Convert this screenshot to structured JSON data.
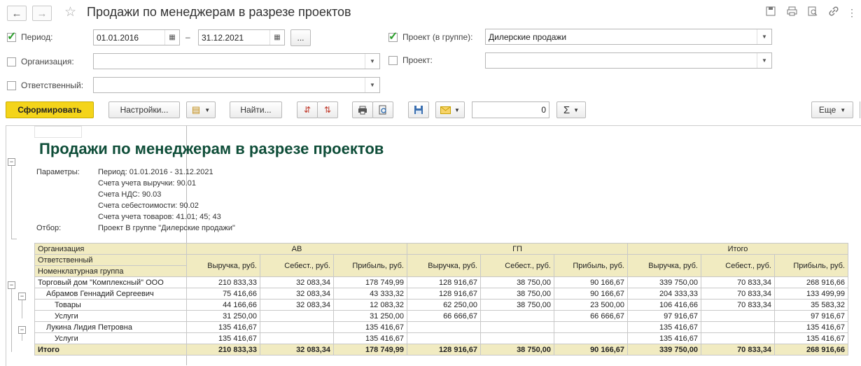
{
  "window": {
    "title": "Продажи по менеджерам в разрезе проектов",
    "back_icon": "arrow-left-icon",
    "forward_icon": "arrow-right-icon"
  },
  "form": {
    "period": {
      "label": "Период:",
      "checked": true,
      "from": "01.01.2016",
      "dash": "–",
      "to": "31.12.2021",
      "more": "..."
    },
    "organization": {
      "label": "Организация:",
      "checked": false,
      "value": ""
    },
    "responsible": {
      "label": "Ответственный:",
      "checked": false,
      "value": ""
    },
    "project_group": {
      "label": "Проект (в группе):",
      "checked": true,
      "value": "Дилерские продажи"
    },
    "project": {
      "label": "Проект:",
      "checked": false,
      "value": ""
    }
  },
  "toolbar": {
    "generate": "Сформировать",
    "settings": "Настройки...",
    "find": "Найти...",
    "sum_value": "0",
    "sigma": "Σ",
    "more": "Еще"
  },
  "report": {
    "title": "Продажи по менеджерам в разрезе проектов",
    "params_label": "Параметры:",
    "params": [
      "Период: 01.01.2016 - 31.12.2021",
      "Счета учета выручки: 90.01",
      "Счета НДС: 90.03",
      "Счета себестоимости: 90.02",
      "Счета учета товаров: 41.01; 45; 43"
    ],
    "filter_label": "Отбор:",
    "filter": "Проект В группе \"Дилерские продажи\"",
    "header": {
      "org": "Организация",
      "resp": "Ответственный",
      "group": "Номенклатурная группа",
      "projects": [
        "АВ",
        "ГП",
        "Итого"
      ],
      "cols": [
        "Выручка, руб.",
        "Себест., руб.",
        "Прибыль, руб."
      ]
    },
    "rows": [
      {
        "name": "Торговый дом \"Комплексный\" ООО",
        "v": [
          "210 833,33",
          "32 083,34",
          "178 749,99",
          "128 916,67",
          "38 750,00",
          "90 166,67",
          "339 750,00",
          "70 833,34",
          "268 916,66"
        ]
      },
      {
        "name": "Абрамов Геннадий Сергеевич",
        "v": [
          "75 416,66",
          "32 083,34",
          "43 333,32",
          "128 916,67",
          "38 750,00",
          "90 166,67",
          "204 333,33",
          "70 833,34",
          "133 499,99"
        ]
      },
      {
        "name": "Товары",
        "v": [
          "44 166,66",
          "32 083,34",
          "12 083,32",
          "62 250,00",
          "38 750,00",
          "23 500,00",
          "106 416,66",
          "70 833,34",
          "35 583,32"
        ]
      },
      {
        "name": "Услуги",
        "v": [
          "31 250,00",
          "",
          "31 250,00",
          "66 666,67",
          "",
          "66 666,67",
          "97 916,67",
          "",
          "97 916,67"
        ]
      },
      {
        "name": "Лукина Лидия Петровна",
        "v": [
          "135 416,67",
          "",
          "135 416,67",
          "",
          "",
          "",
          "135 416,67",
          "",
          "135 416,67"
        ]
      },
      {
        "name": "Услуги",
        "v": [
          "135 416,67",
          "",
          "135 416,67",
          "",
          "",
          "",
          "135 416,67",
          "",
          "135 416,67"
        ]
      }
    ],
    "total": {
      "name": "Итого",
      "v": [
        "210 833,33",
        "32 083,34",
        "178 749,99",
        "128 916,67",
        "38 750,00",
        "90 166,67",
        "339 750,00",
        "70 833,34",
        "268 916,66"
      ]
    }
  }
}
